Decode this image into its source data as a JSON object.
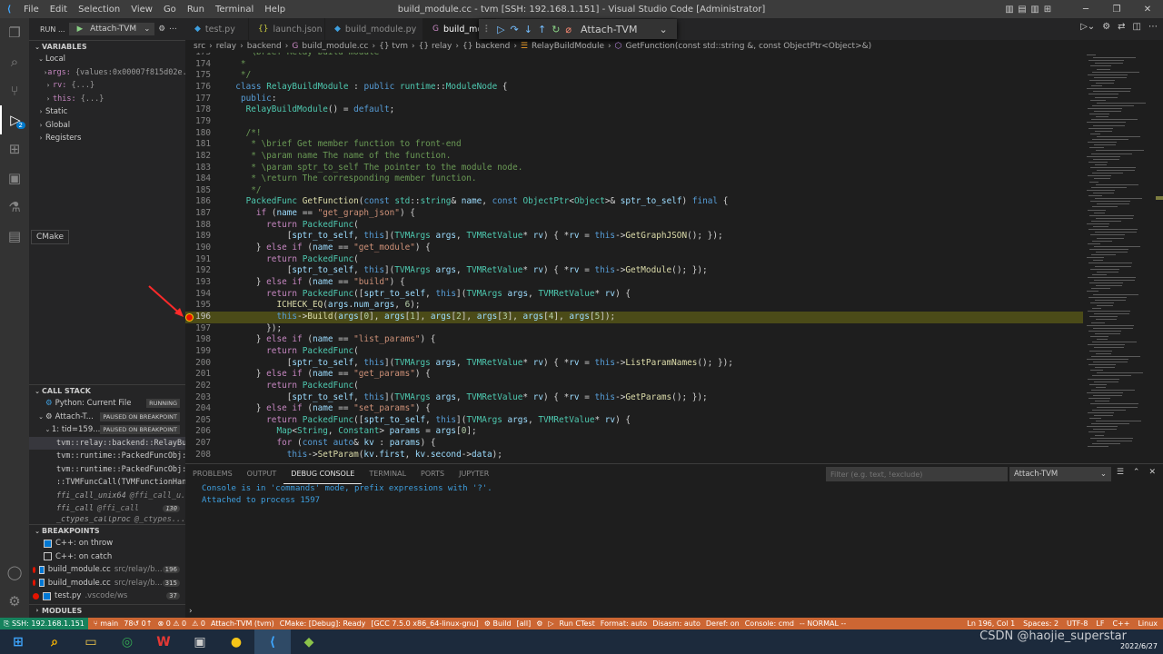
{
  "titlebar": {
    "menu": [
      "File",
      "Edit",
      "Selection",
      "View",
      "Go",
      "Run",
      "Terminal",
      "Help"
    ],
    "title": "build_module.cc - tvm [SSH: 192.168.1.151] - Visual Studio Code [Administrator]"
  },
  "activity": {
    "icons": [
      "explorer-icon",
      "search-icon",
      "source-control-icon",
      "run-debug-icon",
      "extensions-icon",
      "remote-explorer-icon",
      "testing-icon",
      "cmake-icon"
    ],
    "debug_badge": "2",
    "tooltip": "CMake"
  },
  "sidebar": {
    "run_label": "RUN ...",
    "config": "Attach-TVM",
    "variables_title": "VARIABLES",
    "local": "Local",
    "vars": [
      {
        "name": "args:",
        "value": "{values:0x00007f815d02e..."
      },
      {
        "name": "rv:",
        "value": "{...}"
      },
      {
        "name": "this:",
        "value": "{...}"
      }
    ],
    "scopes": [
      "Static",
      "Global",
      "Registers"
    ],
    "callstack_title": "CALL STACK",
    "callstack": [
      {
        "label": "Python: Current File",
        "tag": "RUNNING"
      },
      {
        "label": "Attach-T...",
        "tag": "PAUSED ON BREAKPOINT"
      },
      {
        "label": "1: tid=159...",
        "tag": "PAUSED ON BREAKPOINT"
      }
    ],
    "frames": [
      {
        "label": "tvm::relay::backend::RelayBuil",
        "file": ""
      },
      {
        "label": "tvm::runtime::PackedFuncObj::E",
        "file": ""
      },
      {
        "label": "tvm::runtime::PackedFuncObj::E",
        "file": ""
      },
      {
        "label": "::TVMFuncCall(TVMFunctionHandl",
        "file": ""
      },
      {
        "label": "ffi_call_unix64",
        "file": "@ffi_call_u..."
      },
      {
        "label": "ffi_call",
        "file": "@ffi_call",
        "count": "130"
      },
      {
        "label": "_ctypes_callproc",
        "file": "@_ctypes..."
      }
    ],
    "breakpoints_title": "BREAKPOINTS",
    "breakpoints": [
      {
        "label": "C++: on throw",
        "checked": true,
        "dot": false,
        "path": "",
        "count": ""
      },
      {
        "label": "C++: on catch",
        "checked": false,
        "dot": false,
        "path": "",
        "count": ""
      },
      {
        "label": "build_module.cc",
        "checked": true,
        "dot": true,
        "path": "src/relay/b...",
        "count": "196"
      },
      {
        "label": "build_module.cc",
        "checked": true,
        "dot": true,
        "path": "src/relay/b...",
        "count": "315"
      },
      {
        "label": "test.py",
        "checked": true,
        "dot": true,
        "path": ".vscode/ws",
        "count": "37"
      }
    ],
    "modules_title": "MODULES"
  },
  "tabs": [
    {
      "label": "test.py",
      "icon": "python-file-icon",
      "active": false
    },
    {
      "label": "launch.json",
      "icon": "json-file-icon",
      "active": false
    },
    {
      "label": "build_module.py",
      "icon": "python-file-icon",
      "active": false
    },
    {
      "label": "build_mo",
      "icon": "cpp-file-icon",
      "active": true
    }
  ],
  "debug_toolbar": {
    "config": "Attach-TVM"
  },
  "breadcrumb": [
    "src",
    "relay",
    "backend",
    "build_module.cc",
    "{} tvm",
    "{} relay",
    "{} backend",
    "RelayBuildModule",
    "GetFunction(const std::string &, const ObjectPtr<Object>&)"
  ],
  "editor": {
    "current_line": 196,
    "lines": [
      {
        "n": "173",
        "t": "   * \\brief Relay build module"
      },
      {
        "n": "174",
        "t": "   *"
      },
      {
        "n": "175",
        "t": "   */"
      },
      {
        "n": "176",
        "t": "  class RelayBuildModule : public runtime::ModuleNode {"
      },
      {
        "n": "177",
        "t": "   public:"
      },
      {
        "n": "178",
        "t": "    RelayBuildModule() = default;"
      },
      {
        "n": "179",
        "t": ""
      },
      {
        "n": "180",
        "t": "    /*!"
      },
      {
        "n": "181",
        "t": "     * \\brief Get member function to front-end"
      },
      {
        "n": "182",
        "t": "     * \\param name The name of the function."
      },
      {
        "n": "183",
        "t": "     * \\param sptr_to_self The pointer to the module node."
      },
      {
        "n": "184",
        "t": "     * \\return The corresponding member function."
      },
      {
        "n": "185",
        "t": "     */"
      },
      {
        "n": "186",
        "t": "    PackedFunc GetFunction(const std::string& name, const ObjectPtr<Object>& sptr_to_self) final {"
      },
      {
        "n": "187",
        "t": "      if (name == \"get_graph_json\") {"
      },
      {
        "n": "188",
        "t": "        return PackedFunc("
      },
      {
        "n": "189",
        "t": "            [sptr_to_self, this](TVMArgs args, TVMRetValue* rv) { *rv = this->GetGraphJSON(); });"
      },
      {
        "n": "190",
        "t": "      } else if (name == \"get_module\") {"
      },
      {
        "n": "191",
        "t": "        return PackedFunc("
      },
      {
        "n": "192",
        "t": "            [sptr_to_self, this](TVMArgs args, TVMRetValue* rv) { *rv = this->GetModule(); });"
      },
      {
        "n": "193",
        "t": "      } else if (name == \"build\") {"
      },
      {
        "n": "194",
        "t": "        return PackedFunc([sptr_to_self, this](TVMArgs args, TVMRetValue* rv) {"
      },
      {
        "n": "195",
        "t": "          ICHECK_EQ(args.num_args, 6);"
      },
      {
        "n": "196",
        "t": "          this->Build(args[0], args[1], args[2], args[3], args[4], args[5]);"
      },
      {
        "n": "197",
        "t": "        });"
      },
      {
        "n": "198",
        "t": "      } else if (name == \"list_params\") {"
      },
      {
        "n": "199",
        "t": "        return PackedFunc("
      },
      {
        "n": "200",
        "t": "            [sptr_to_self, this](TVMArgs args, TVMRetValue* rv) { *rv = this->ListParamNames(); });"
      },
      {
        "n": "201",
        "t": "      } else if (name == \"get_params\") {"
      },
      {
        "n": "202",
        "t": "        return PackedFunc("
      },
      {
        "n": "203",
        "t": "            [sptr_to_self, this](TVMArgs args, TVMRetValue* rv) { *rv = this->GetParams(); });"
      },
      {
        "n": "204",
        "t": "      } else if (name == \"set_params\") {"
      },
      {
        "n": "205",
        "t": "        return PackedFunc([sptr_to_self, this](TVMArgs args, TVMRetValue* rv) {"
      },
      {
        "n": "206",
        "t": "          Map<String, Constant> params = args[0];"
      },
      {
        "n": "207",
        "t": "          for (const auto& kv : params) {"
      },
      {
        "n": "208",
        "t": "            this->SetParam(kv.first, kv.second->data);"
      }
    ]
  },
  "panel": {
    "tabs": [
      "PROBLEMS",
      "OUTPUT",
      "DEBUG CONSOLE",
      "TERMINAL",
      "PORTS",
      "JUPYTER"
    ],
    "active_tab": "DEBUG CONSOLE",
    "filter_placeholder": "Filter (e.g. text, !exclude)",
    "session": "Attach-TVM",
    "console": [
      "Console is in 'commands' mode, prefix expressions with '?'.",
      "Attached to process 1597"
    ]
  },
  "statusbar": {
    "remote": "SSH: 192.168.1.151",
    "items": [
      "main",
      "78↺ 0↑",
      "⊗ 0 ⚠ 0",
      "⚠ 0",
      "Attach-TVM (tvm)",
      "CMake: [Debug]: Ready",
      "[GCC 7.5.0 x86_64-linux-gnu]",
      "Build",
      "[all]",
      "Run CTest",
      "Format: auto",
      "Disasm: auto",
      "Deref: on",
      "Console: cmd",
      "-- NORMAL --"
    ],
    "right": [
      "Ln 196, Col 1",
      "Spaces: 2",
      "UTF-8",
      "LF",
      "C++",
      "Linux"
    ]
  },
  "taskbar": {
    "watermark": "CSDN @haojie_superstar",
    "date": "2022/6/27"
  },
  "colors": {
    "statusbar": "#cc6633",
    "remote": "#16825d",
    "accent": "#007acc",
    "current_line": "#4b4b18",
    "breakpoint": "#e51400"
  }
}
